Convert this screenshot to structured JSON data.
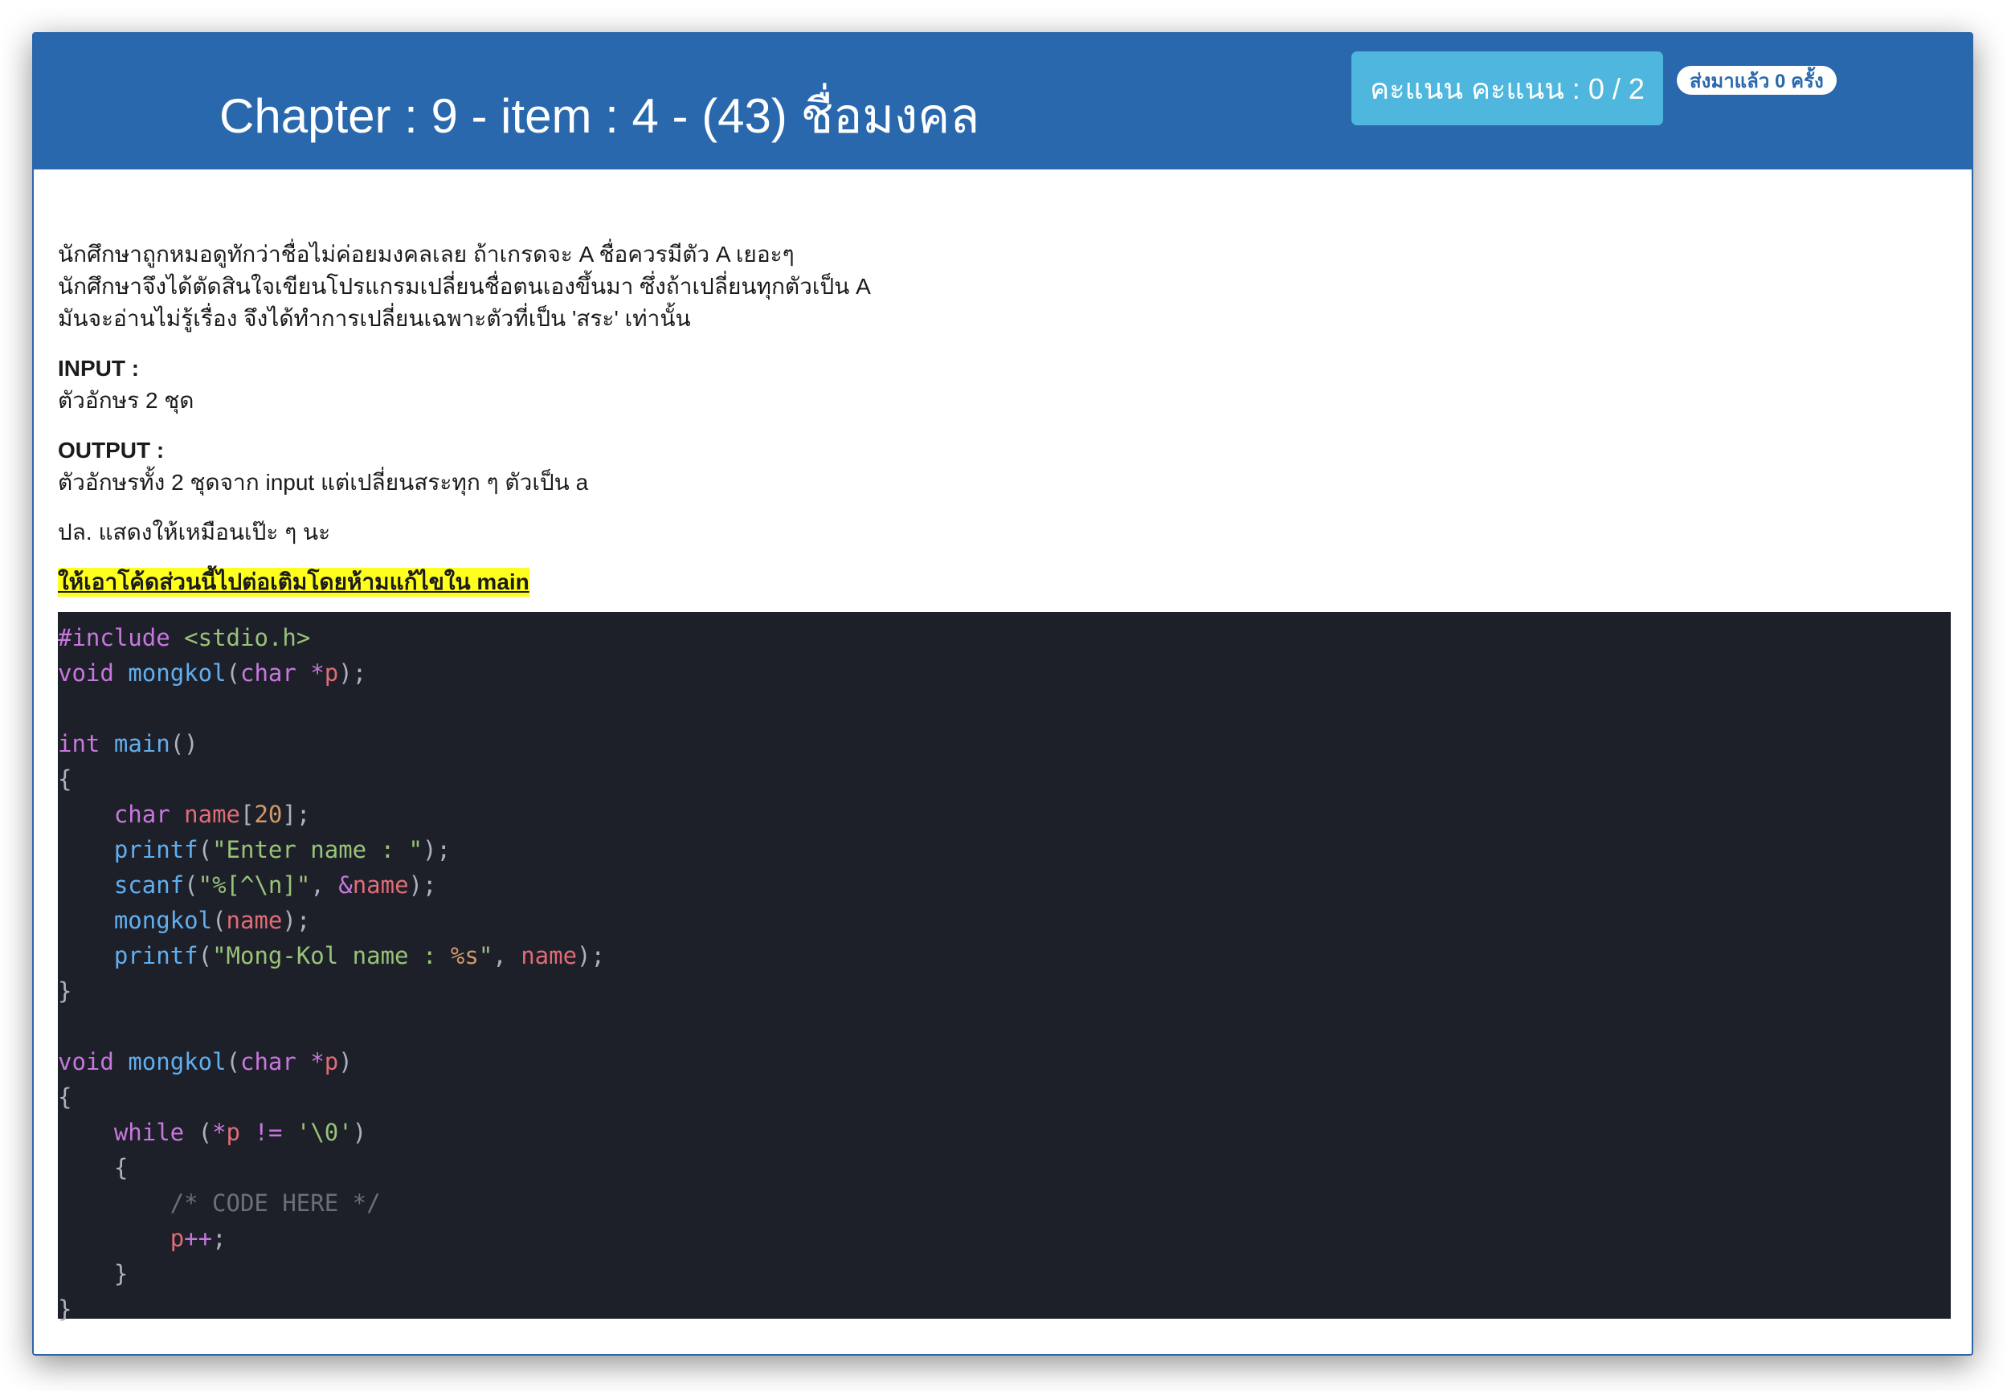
{
  "header": {
    "title": "Chapter : 9 - item : 4 - (43) ชื่อมงคล",
    "score_label": "คะแนน คะแนน : 0 / 2",
    "submit_badge": "ส่งมาแล้ว 0 ครั้ง"
  },
  "description": {
    "lines": [
      "นักศึกษาถูกหมอดูทักว่าชื่อไม่ค่อยมงคลเลย ถ้าเกรดจะ A ชื่อควรมีตัว A เยอะๆ",
      "นักศึกษาจึงได้ตัดสินใจเขียนโปรแกรมเปลี่ยนชื่อตนเองขึ้นมา ซึ่งถ้าเปลี่ยนทุกตัวเป็น A",
      "มันจะอ่านไม่รู้เรื่อง จึงได้ทำการเปลี่ยนเฉพาะตัวที่เป็น 'สระ' เท่านั้น"
    ],
    "input_label": "INPUT :",
    "input_text": "ตัวอักษร 2 ชุด",
    "output_label": "OUTPUT :",
    "output_text": "ตัวอักษรทั้ง 2 ชุดจาก input แต่เปลี่ยนสระทุก ๆ ตัวเป็น a",
    "note": "ปล. แสดงให้เหมือนเป๊ะ ๆ นะ",
    "highlight": "ให้เอาโค้ดส่วนนี้ไปต่อเติมโดยห้ามแก้ไขใน main"
  },
  "code_lines": [
    "#include <stdio.h>",
    "void mongkol(char *p);",
    "",
    "int main()",
    "{",
    "    char name[20];",
    "    printf(\"Enter name : \");",
    "    scanf(\"%[^\\n]\", &name);",
    "    mongkol(name);",
    "    printf(\"Mong-Kol name : %s\", name);",
    "}",
    "",
    "void mongkol(char *p)",
    "{",
    "    while (*p != '\\0')",
    "    {",
    "        /* CODE HERE */",
    "        p++;",
    "    }",
    "}"
  ]
}
